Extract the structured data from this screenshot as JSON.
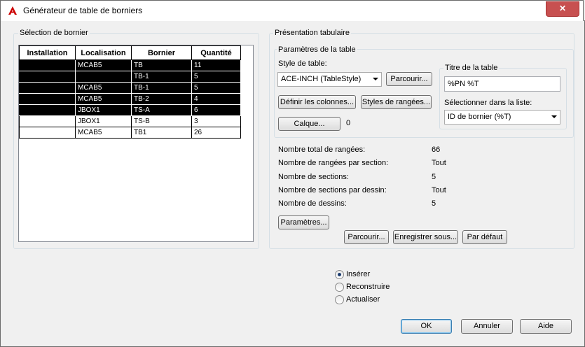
{
  "window": {
    "title": "Générateur de table de borniers",
    "close_glyph": "✕"
  },
  "left_group": {
    "label": "Sélection de bornier",
    "columns": [
      "Installation",
      "Localisation",
      "Bornier",
      "Quantité"
    ],
    "rows": [
      {
        "installation": "",
        "localisation": "MCAB5",
        "bornier": "TB",
        "quantite": "11",
        "selected": true
      },
      {
        "installation": "",
        "localisation": "",
        "bornier": "TB-1",
        "quantite": "5",
        "selected": true
      },
      {
        "installation": "",
        "localisation": "MCAB5",
        "bornier": "TB-1",
        "quantite": "5",
        "selected": true
      },
      {
        "installation": "",
        "localisation": "MCAB5",
        "bornier": "TB-2",
        "quantite": "4",
        "selected": true
      },
      {
        "installation": "",
        "localisation": "JBOX1",
        "bornier": "TS-A",
        "quantite": "6",
        "selected": true
      },
      {
        "installation": "",
        "localisation": "JBOX1",
        "bornier": "TS-B",
        "quantite": "3",
        "selected": false
      },
      {
        "installation": "",
        "localisation": "MCAB5",
        "bornier": "TB1",
        "quantite": "26",
        "selected": false
      }
    ]
  },
  "right_group": {
    "label": "Présentation tabulaire",
    "params_label": "Paramètres de la table",
    "style_label": "Style de table:",
    "style_value": "ACE-INCH (TableStyle)",
    "browse1": "Parcourir...",
    "define_columns": "Définir les colonnes...",
    "row_styles": "Styles de rangées...",
    "layer_btn": "Calque...",
    "layer_value": "0",
    "title_group_label": "Titre de la table",
    "title_value": "%PN %T",
    "select_list_label": "Sélectionner dans la liste:",
    "select_list_value": "ID de bornier (%T)",
    "stats": [
      {
        "label": "Nombre total de rangées:",
        "value": "66"
      },
      {
        "label": "Nombre de rangées par section:",
        "value": "Tout"
      },
      {
        "label": "Nombre de sections:",
        "value": "5"
      },
      {
        "label": "Nombre de sections par dessin:",
        "value": "Tout"
      },
      {
        "label": "Nombre de dessins:",
        "value": "5"
      }
    ],
    "settings_btn": "Paramètres...",
    "browse2": "Parcourir...",
    "save_as": "Enregistrer sous...",
    "default_btn": "Par défaut"
  },
  "radios": [
    {
      "label": "Insérer",
      "checked": true
    },
    {
      "label": "Reconstruire",
      "checked": false
    },
    {
      "label": "Actualiser",
      "checked": false
    }
  ],
  "footer": {
    "ok": "OK",
    "cancel": "Annuler",
    "help": "Aide"
  }
}
